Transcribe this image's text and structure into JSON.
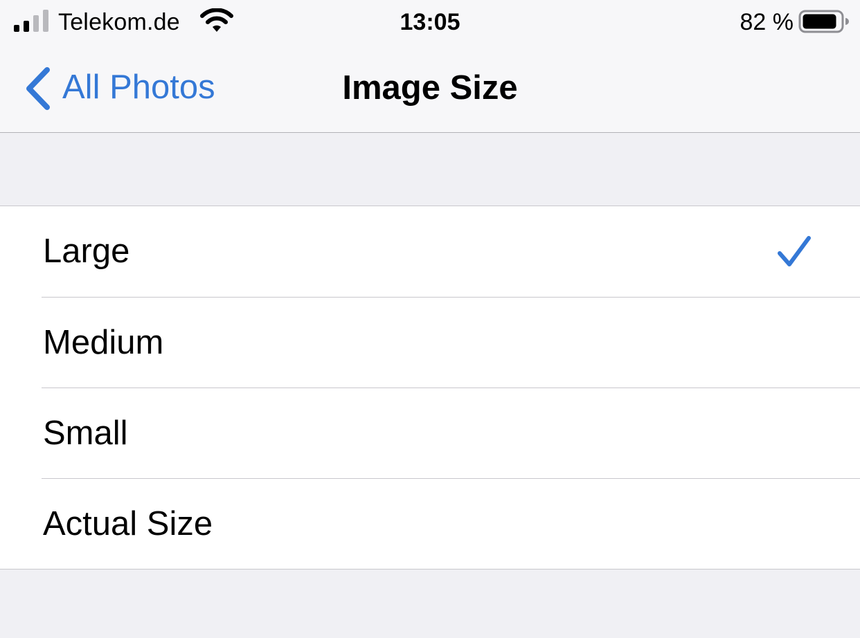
{
  "status_bar": {
    "carrier": "Telekom.de",
    "time": "13:05",
    "battery_percent": "82 %",
    "icons": [
      "signal-bars-icon",
      "wifi-icon",
      "battery-icon"
    ]
  },
  "nav_bar": {
    "back_label": "All Photos",
    "title": "Image Size"
  },
  "options": [
    {
      "label": "Large",
      "selected": true
    },
    {
      "label": "Medium",
      "selected": false
    },
    {
      "label": "Small",
      "selected": false
    },
    {
      "label": "Actual Size",
      "selected": false
    }
  ],
  "colors": {
    "accent": "#3478d6",
    "background": "#f0f0f4",
    "nav_background": "#f7f7f9",
    "row_background": "#ffffff",
    "separator": "#c8c7cc"
  }
}
